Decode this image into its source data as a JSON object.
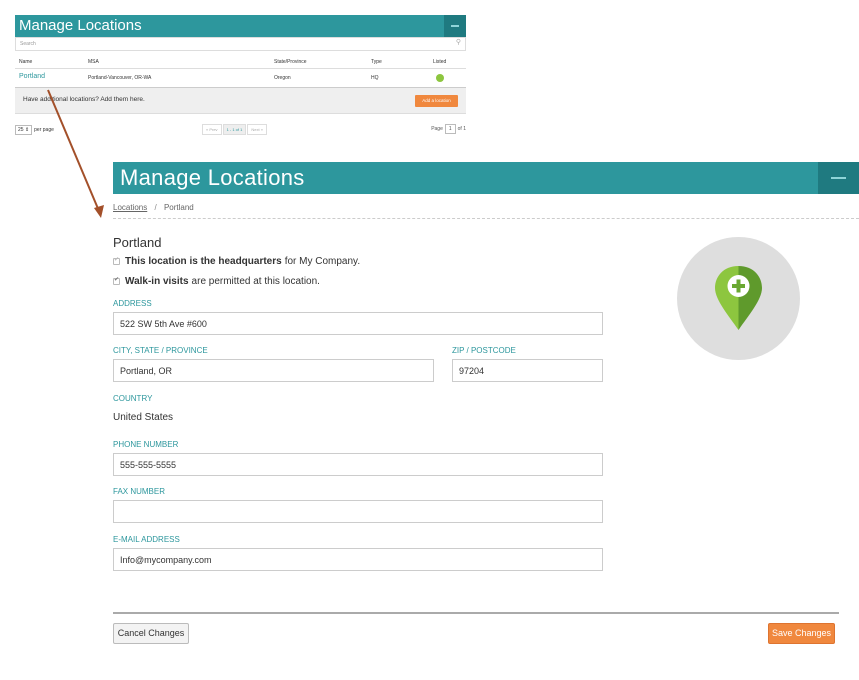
{
  "small_panel": {
    "title": "Manage Locations",
    "search_placeholder": "Search",
    "columns": [
      "Name",
      "MSA",
      "State/Province",
      "Type",
      "Listed"
    ],
    "row": {
      "name": "Portland",
      "msa": "Portland-Vancouver, OR-WA",
      "state": "Oregon",
      "type": "HQ",
      "listed_color": "#8dc63f"
    },
    "add_text": "Have additional locations? Add them here.",
    "add_button": "Add a location",
    "per_page_value": "25 ⇕",
    "per_page_label": "per page",
    "pager_prev": "« Prev",
    "pager_current": "1 - 1 of 1",
    "pager_next": "Next »",
    "page_label": "Page",
    "page_value": "1",
    "page_of": "of 1"
  },
  "large_panel": {
    "title": "Manage Locations",
    "breadcrumb_link": "Locations",
    "breadcrumb_sep": "/",
    "breadcrumb_current": "Portland",
    "location_name": "Portland",
    "hq_bold": "This location is the headquarters",
    "hq_rest": "for My Company.",
    "walkin_bold": "Walk-in visits",
    "walkin_rest": "are permitted at this location.",
    "address_label": "ADDRESS",
    "address_value": "522 SW 5th Ave #600",
    "city_label": "CITY, STATE / PROVINCE",
    "city_value": "Portland, OR",
    "zip_label": "ZIP / POSTCODE",
    "zip_value": "97204",
    "country_label": "COUNTRY",
    "country_value": "United States",
    "phone_label": "PHONE NUMBER",
    "phone_value": "555-555-5555",
    "fax_label": "FAX NUMBER",
    "fax_value": "",
    "email_label": "E-MAIL ADDRESS",
    "email_value": "Info@mycompany.com",
    "cancel_button": "Cancel Changes",
    "save_button": "Save Changes"
  },
  "colors": {
    "teal": "#2d979d",
    "orange": "#f0883e",
    "pin_green": "#8dc63f",
    "arrow": "#a3502a"
  }
}
